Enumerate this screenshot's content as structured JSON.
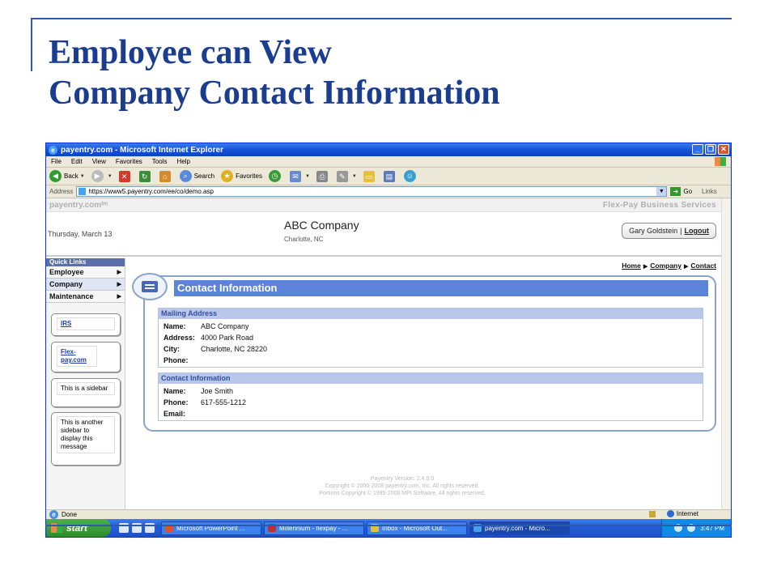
{
  "slide": {
    "title_line1": "Employee can View",
    "title_line2": "Company Contact Information"
  },
  "browser": {
    "window_title": "payentry.com - Microsoft Internet Explorer",
    "menu": [
      "File",
      "Edit",
      "View",
      "Favorites",
      "Tools",
      "Help"
    ],
    "toolbar": {
      "back": "Back",
      "search": "Search",
      "favorites": "Favorites"
    },
    "address_label": "Address",
    "url": "https://www5.payentry.com/ee/co/demo.asp",
    "go_label": "Go",
    "links_label": "Links",
    "status": "Done",
    "zone": "Internet"
  },
  "page": {
    "brand": "payentry.comᵗᵐ",
    "service": "Flex-Pay Business Services",
    "date": "Thursday, March 13",
    "company_name": "ABC Company",
    "company_location": "Charlotte, NC",
    "user_name": "Gary Goldstein",
    "separator": "|",
    "logout": "Logout",
    "quick_links_title": "Quick Links",
    "quick_links": [
      {
        "label": "Employee"
      },
      {
        "label": "Company"
      },
      {
        "label": "Maintenance"
      }
    ],
    "sidebar": {
      "irs": "IRS",
      "flexpay": "Flex-pay.com",
      "box1": "This is a sidebar",
      "box2": "This is another sidebar to display this message"
    },
    "breadcrumb": [
      "Home",
      "Company",
      "Contact"
    ],
    "panel_title": "Contact Information",
    "mailing": {
      "title": "Mailing Address",
      "rows": [
        {
          "label": "Name:",
          "value": "ABC Company"
        },
        {
          "label": "Address:",
          "value": "4000 Park Road"
        },
        {
          "label": "City:",
          "value": "Charlotte, NC 28220"
        },
        {
          "label": "Phone:",
          "value": ""
        }
      ]
    },
    "contact": {
      "title": "Contact Information",
      "rows": [
        {
          "label": "Name:",
          "value": "Joe Smith"
        },
        {
          "label": "Phone:",
          "value": "617-555-1212"
        },
        {
          "label": "Email:",
          "value": ""
        }
      ]
    },
    "footer": [
      "Payentry Version: 2.4.0.0",
      "Copyright © 2000-2008 payentry.com, Inc. All rights reserved.",
      "Portions Copyright © 1995-2008 MPI Software. All rights reserved."
    ]
  },
  "taskbar": {
    "start": "start",
    "tasks": [
      "Microsoft PowerPoint ...",
      "Millennium - flexpay - ...",
      "Inbox - Microsoft Out...",
      "payentry.com - Micro..."
    ],
    "clock": "3:47 PM"
  }
}
